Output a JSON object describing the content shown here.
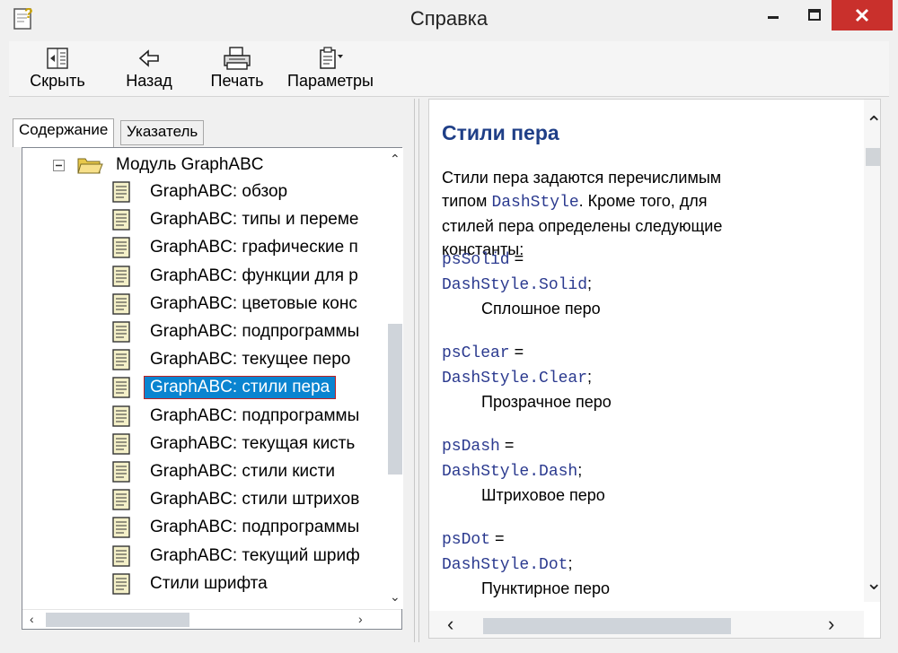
{
  "window": {
    "title": "Справка"
  },
  "toolbar": {
    "hide_label": "Скрыть",
    "back_label": "Назад",
    "print_label": "Печать",
    "options_label": "Параметры"
  },
  "tabs": {
    "contents": "Содержание",
    "index": "Указатель"
  },
  "tree": {
    "root": "Модуль GraphABC",
    "items": [
      "GraphABC: обзор",
      "GraphABC: типы и переме",
      "GraphABC: графические п",
      "GraphABC: функции для р",
      "GraphABC: цветовые конс",
      "GraphABC: подпрограммы",
      "GraphABC: текущее перо",
      "GraphABC: стили пера",
      "GraphABC: подпрограммы",
      "GraphABC: текущая кисть",
      "GraphABC: стили кисти",
      "GraphABC: стили штрихов",
      "GraphABC: подпрограммы",
      "GraphABC: текущий шриф",
      "Стили шрифта"
    ],
    "selected_index": 7
  },
  "article": {
    "heading": "Стили пера",
    "intro_1": "Стили пера задаются перечислимым типом",
    "intro_code": "DashStyle",
    "intro_2": ". Кроме того, для стилей пера определены следующие константы:",
    "entries": [
      {
        "const": "psSolid",
        "value": "DashStyle.Solid",
        "desc": "Сплошное перо"
      },
      {
        "const": "psClear",
        "value": "DashStyle.Clear",
        "desc": "Прозрачное перо"
      },
      {
        "const": "psDash",
        "value": "DashStyle.Dash",
        "desc": "Штриховое перо"
      },
      {
        "const": "psDot",
        "value": "DashStyle.Dot",
        "desc": "Пунктирное перо"
      }
    ],
    "equals": " =",
    "semicolon": ";"
  }
}
